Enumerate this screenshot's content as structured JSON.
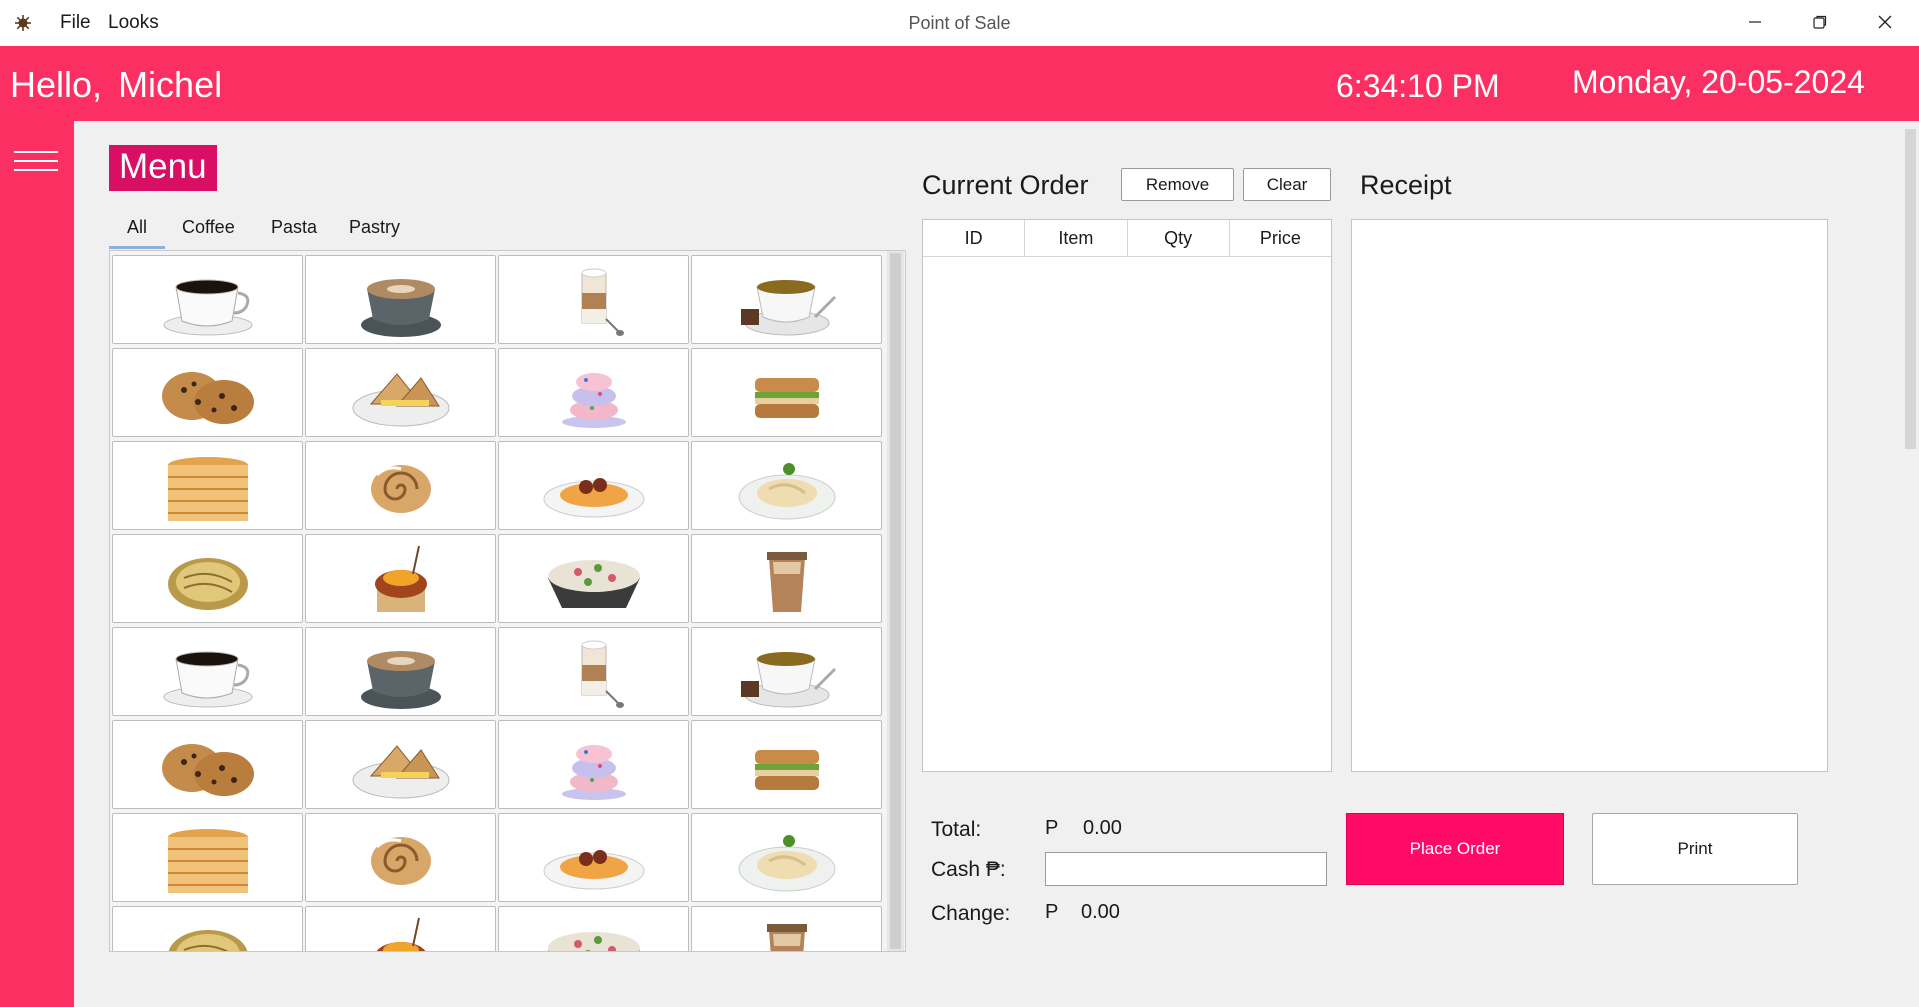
{
  "window": {
    "title": "Point of Sale",
    "menus": [
      "File",
      "Looks"
    ],
    "controls": [
      "minimize-icon",
      "restore-icon",
      "close-icon"
    ]
  },
  "header": {
    "greeting": "Hello,",
    "user": "Michel",
    "time": "6:34:10 PM",
    "date": "Monday, 20-05-2024"
  },
  "menu": {
    "title": "Menu",
    "tabs": [
      "All",
      "Coffee",
      "Pasta",
      "Pastry"
    ],
    "selected_tab": "All",
    "items": [
      "black-coffee-icon",
      "cappuccino-icon",
      "latte-macchiato-icon",
      "tea-icon",
      "cookies-icon",
      "grilled-sandwich-icon",
      "sprinkle-donut-icon",
      "club-sandwich-icon",
      "pancakes-icon",
      "cinnamon-roll-icon",
      "spaghetti-meatballs-icon",
      "carbonara-icon",
      "noodles-icon",
      "flan-cake-icon",
      "pasta-salad-icon",
      "iced-coffee-icon",
      "black-coffee-icon",
      "cappuccino-icon",
      "latte-macchiato-icon",
      "tea-icon",
      "cookies-icon",
      "grilled-sandwich-icon",
      "sprinkle-donut-icon",
      "club-sandwich-icon",
      "pancakes-icon",
      "cinnamon-roll-icon",
      "spaghetti-meatballs-icon",
      "carbonara-icon",
      "noodles-icon",
      "flan-cake-icon",
      "pasta-salad-icon",
      "iced-coffee-icon"
    ]
  },
  "order": {
    "title": "Current Order",
    "remove_label": "Remove",
    "clear_label": "Clear",
    "columns": [
      "ID",
      "Item",
      "Qty",
      "Price"
    ],
    "rows": []
  },
  "receipt": {
    "title": "Receipt",
    "content": ""
  },
  "totals": {
    "total_label": "Total:",
    "total_currency": "P",
    "total_value": "0.00",
    "cash_label": "Cash ₱:",
    "cash_value": "",
    "change_label": "Change:",
    "change_currency": "P",
    "change_value": "0.00"
  },
  "actions": {
    "place_order_label": "Place Order",
    "print_label": "Print"
  },
  "colors": {
    "accent": "#fc2f62",
    "menu_badge": "#d80f64",
    "place_order": "#ff0a66"
  }
}
